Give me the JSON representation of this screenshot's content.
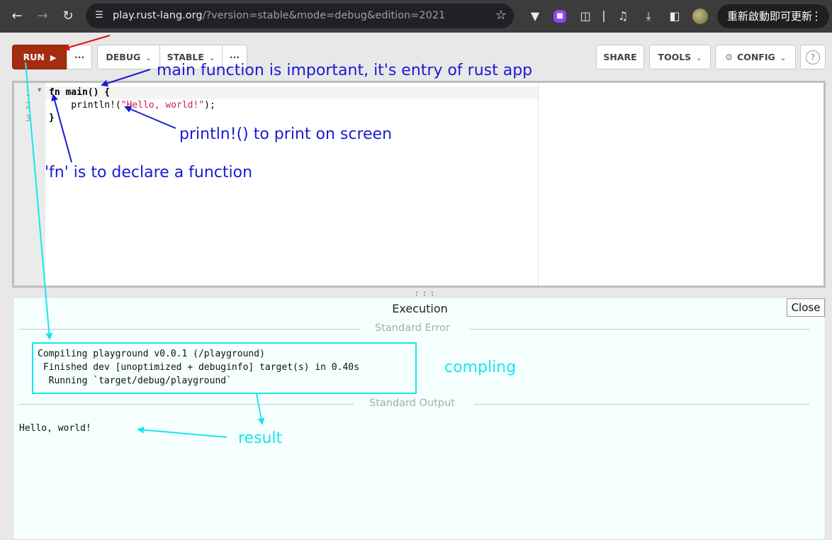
{
  "browser": {
    "url_host": "play.rust-lang.org",
    "url_rest": "/?version=stable&mode=debug&edition=2021",
    "update_button": "重新啟動即可更新",
    "icons": [
      "back-arrow-icon",
      "forward-arrow-icon",
      "reload-icon",
      "site-settings-icon",
      "bookmark-star-icon",
      "extension-v-icon",
      "extension-purple-icon",
      "puzzle-icon",
      "media-icon",
      "download-icon",
      "side-panel-icon",
      "avatar",
      "menu-dots-icon"
    ]
  },
  "toolbar": {
    "run_label": "RUN",
    "more_label": "···",
    "mode_label": "DEBUG",
    "channel_label": "STABLE",
    "more2_label": "···",
    "share_label": "SHARE",
    "tools_label": "TOOLS",
    "config_label": "CONFIG",
    "help_label": "?"
  },
  "editor": {
    "line_numbers": [
      "1",
      "2",
      "3"
    ],
    "line1_kw": "fn",
    "line1_rest": " main() {",
    "line2_pre": "    println!(",
    "line2_str": "\"Hello, world!\"",
    "line2_post": ");",
    "line3": "}"
  },
  "output": {
    "title": "Execution",
    "close_label": "Close",
    "stderr_label": "Standard Error",
    "stderr_lines": [
      "Compiling playground v0.0.1 (/playground)",
      " Finished dev [unoptimized + debuginfo] target(s) in 0.40s",
      "  Running `target/debug/playground`"
    ],
    "stdout_label": "Standard Output",
    "stdout": "Hello, world!"
  },
  "annotations": {
    "main_note": "main function is important, it's entry of rust app",
    "println_note": "println!() to print on screen",
    "fn_note": "'fn' is to declare a function",
    "compiling_note": "compling",
    "result_note": "result",
    "colors": {
      "blue": "#1a1ad6",
      "cyan": "#18e6ee",
      "red": "#e01010"
    }
  },
  "theme": {
    "run_bg": "#a42c0f",
    "output_bg": "#f5fffe",
    "chrome_bg": "#3c3c3c"
  }
}
